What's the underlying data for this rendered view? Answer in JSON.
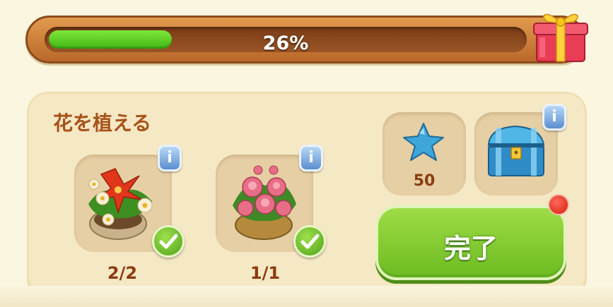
{
  "progress": {
    "percent_label": "26%",
    "fraction": 0.26,
    "fill_color": "#4cc11c"
  },
  "gift_icon": "gift-box-icon",
  "quest": {
    "title": "花を植える",
    "items": [
      {
        "icon": "red-lily-daisy-planter-icon",
        "count": "2/2",
        "completed": true,
        "info_label": "i"
      },
      {
        "icon": "pink-peony-planter-icon",
        "count": "1/1",
        "completed": true,
        "info_label": "i"
      }
    ]
  },
  "rewards": [
    {
      "icon": "blue-star-icon",
      "value": "50"
    },
    {
      "icon": "blue-treasure-chest-icon",
      "info_label": "i"
    }
  ],
  "complete_button": {
    "label": "完了"
  },
  "colors": {
    "button_green": "#7cc52b",
    "title_brown": "#a8521a",
    "count_brown": "#8a3c10",
    "notification_red": "#e0261a"
  }
}
